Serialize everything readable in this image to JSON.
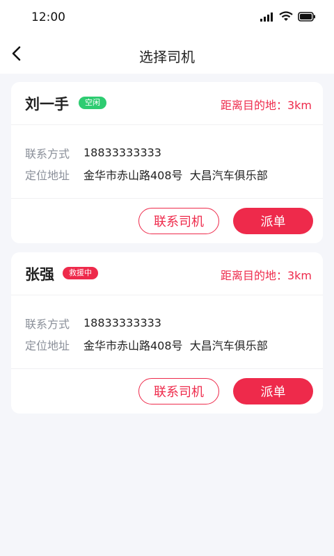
{
  "status_bar": {
    "time": "12:00",
    "icons": [
      "signal-icon",
      "wifi-icon",
      "battery-icon"
    ]
  },
  "nav": {
    "title": "选择司机",
    "back_icon": "chevron-left-icon"
  },
  "drivers": [
    {
      "name": "刘一手",
      "status": "空闲",
      "status_color": "#2ecc71",
      "distance": "距离目的地：3km",
      "contact_label": "联系方式",
      "contact_value": "18833333333",
      "address_label": "定位地址",
      "address_value": "金华市赤山路408号  大昌汽车俱乐部",
      "contact_button": "联系司机",
      "dispatch_button": "派单"
    },
    {
      "name": "张强",
      "status": "救援中",
      "status_color": "#ee2a4b",
      "distance": "距离目的地：3km",
      "contact_label": "联系方式",
      "contact_value": "18833333333",
      "address_label": "定位地址",
      "address_value": "金华市赤山路408号  大昌汽车俱乐部",
      "contact_button": "联系司机",
      "dispatch_button": "派单"
    }
  ],
  "colors": {
    "accent": "#ee2a4b",
    "free": "#2ecc71",
    "background": "#f5f6fa"
  }
}
